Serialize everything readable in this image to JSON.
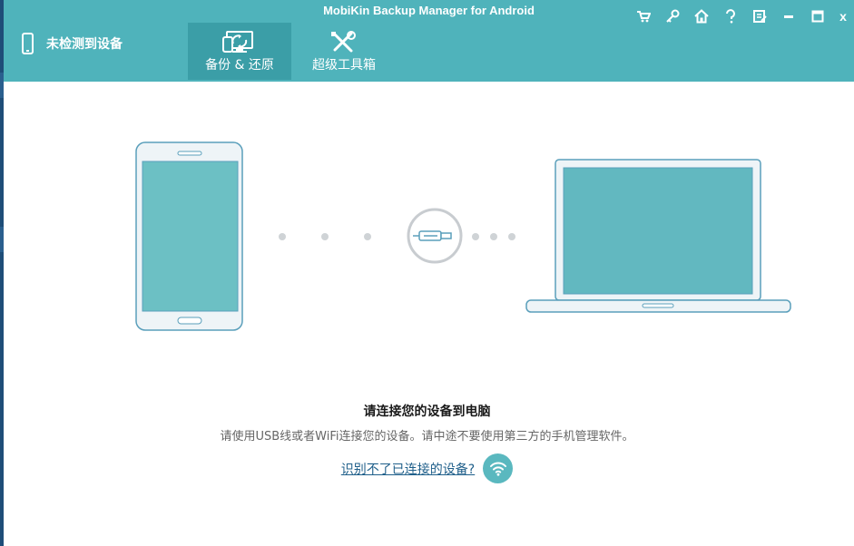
{
  "app": {
    "window_title": "MobiKin Backup Manager for Android"
  },
  "device_status": {
    "label": "未检测到设备"
  },
  "tabs": [
    {
      "label": "备份 & 还原",
      "icon": "backup-restore-icon",
      "active": true
    },
    {
      "label": "超级工具箱",
      "icon": "toolbox-icon",
      "active": false
    }
  ],
  "title_bar_icons": [
    "cart-icon",
    "key-icon",
    "home-icon",
    "help-icon",
    "feedback-icon",
    "minimize-icon",
    "maximize-icon",
    "close-icon"
  ],
  "title_bar_close_glyph": "x",
  "colors": {
    "header": "#4fb3bb",
    "active_tab": "#3b9ea7",
    "device_screen": "#6cc0c4",
    "outline": "#5a9fbb"
  },
  "main": {
    "heading": "请连接您的设备到电脑",
    "subtext": "请使用USB线或者WiFi连接您的设备。请中途不要使用第三方的手机管理软件。",
    "help_link": "识别不了已连接的设备?",
    "wifi_icon": "wifi-icon",
    "connector_icon": "usb-cable-icon"
  }
}
